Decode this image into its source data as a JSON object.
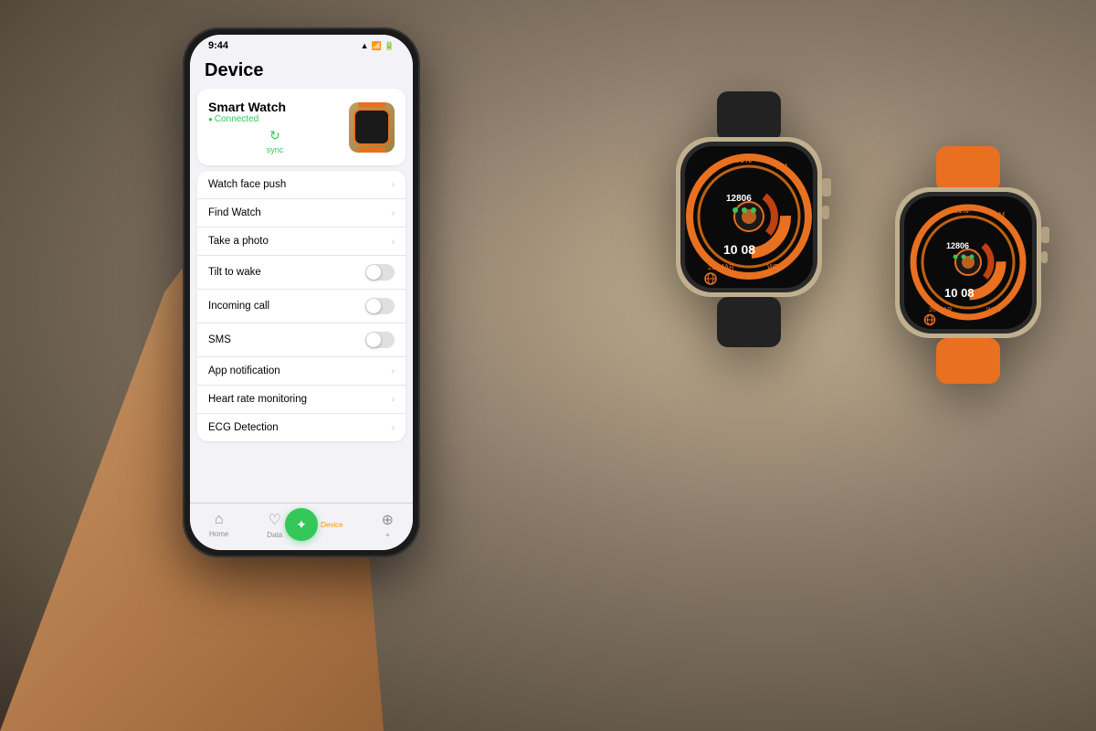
{
  "background": {
    "color": "#8a7a6a"
  },
  "phone": {
    "status_bar": {
      "time": "9:44",
      "icons": "▲ ◀ ▮"
    },
    "page_title": "Device",
    "device_card": {
      "name": "Smart Watch",
      "status": "Connected",
      "sync_label": "sync"
    },
    "menu_items": [
      {
        "label": "Watch face push",
        "type": "chevron"
      },
      {
        "label": "Find Watch",
        "type": "chevron"
      },
      {
        "label": "Take a photo",
        "type": "chevron"
      },
      {
        "label": "Tilt to wake",
        "type": "toggle",
        "on": false
      },
      {
        "label": "Incoming call",
        "type": "toggle",
        "on": false
      },
      {
        "label": "SMS",
        "type": "toggle",
        "on": false
      },
      {
        "label": "App notification",
        "type": "chevron"
      },
      {
        "label": "Heart rate monitoring",
        "type": "chevron"
      },
      {
        "label": "ECG Detection",
        "type": "chevron"
      }
    ],
    "tab_bar": {
      "tabs": [
        {
          "icon": "🏠",
          "label": "Home",
          "active": false
        },
        {
          "icon": "❤️",
          "label": "Data",
          "active": false
        },
        {
          "icon": "⌚",
          "label": "Device",
          "active": true
        },
        {
          "icon": "⊕",
          "label": "Add",
          "active": false
        }
      ]
    }
  },
  "smartwatch_label": "Smart Watch",
  "watches": {
    "black": {
      "battery": "100%",
      "steps": "12806",
      "time": "10 08",
      "date": "28 MAR",
      "day": "WED",
      "period": "AM"
    },
    "orange": {
      "battery": "100%",
      "steps": "12806",
      "time": "10 08",
      "date": "26 MAR",
      "day": "WED",
      "period": "AM"
    }
  }
}
